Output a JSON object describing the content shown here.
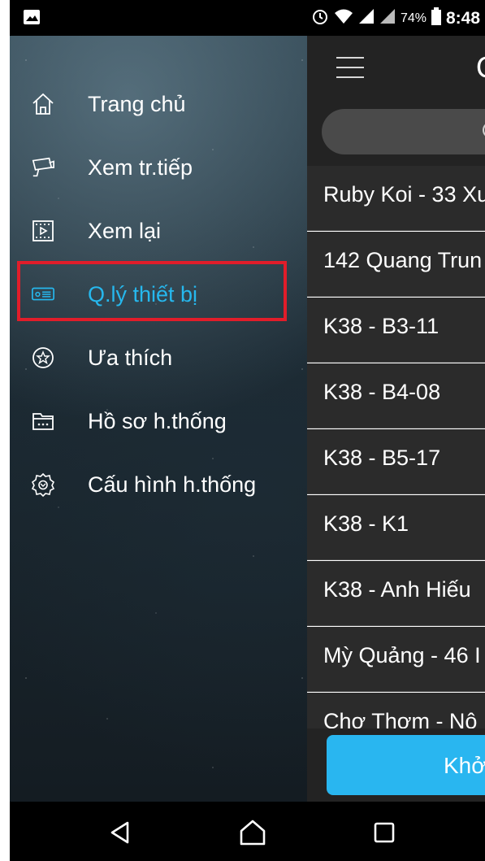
{
  "status_bar": {
    "battery": "74%",
    "time": "8:48",
    "icons": [
      "image-icon",
      "alarm-icon",
      "wifi-icon",
      "signal-icon",
      "signal-icon",
      "battery-icon"
    ]
  },
  "drawer": {
    "items": [
      {
        "label": "Trang chủ",
        "icon": "home-icon"
      },
      {
        "label": "Xem tr.tiếp",
        "icon": "camera-icon"
      },
      {
        "label": "Xem lại",
        "icon": "playback-icon"
      },
      {
        "label": "Q.lý thiết bị",
        "icon": "device-icon",
        "active": true
      },
      {
        "label": "Ưa thích",
        "icon": "star-icon"
      },
      {
        "label": "Hồ sơ h.thống",
        "icon": "folder-icon"
      },
      {
        "label": "Cấu hình h.thống",
        "icon": "gear-icon"
      }
    ],
    "active_color": "#26b8ee",
    "highlight_color": "#e11d2a"
  },
  "panel": {
    "title": "Q",
    "devices": [
      "Ruby Koi - 33 Xu",
      "142 Quang Trun",
      "K38 - B3-11",
      "K38 - B4-08",
      "K38 - B5-17",
      "K38 - K1",
      "K38 - Anh Hiếu",
      "Mỳ Quảng - 46 I",
      "Chợ Thơm - Nô"
    ],
    "button_label": "Khở",
    "accent": "#29b6f0"
  }
}
